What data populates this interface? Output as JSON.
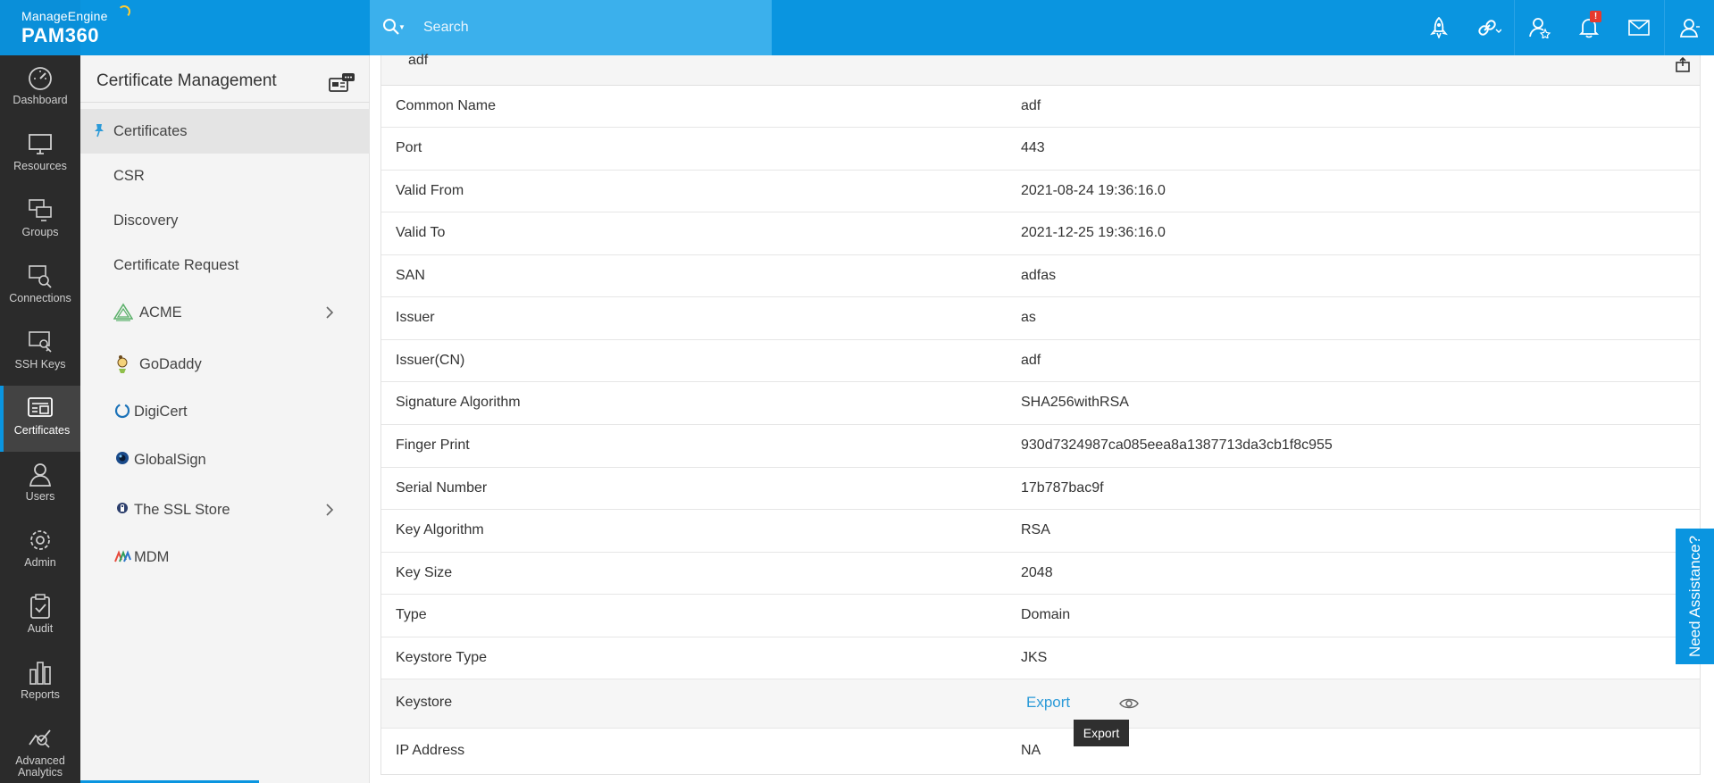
{
  "brand": {
    "small": "ManageEngine",
    "big": "PAM360"
  },
  "search": {
    "placeholder": "Search"
  },
  "top_icons": [
    "rocket-icon",
    "link-icon",
    "user-star-icon",
    "bell-icon",
    "mail-icon",
    "user-icon"
  ],
  "notification_badge": "!",
  "leftnav": {
    "items": [
      {
        "label": "Dashboard",
        "icon": "dashboard-icon"
      },
      {
        "label": "Resources",
        "icon": "monitor-icon"
      },
      {
        "label": "Groups",
        "icon": "groups-icon"
      },
      {
        "label": "Connections",
        "icon": "connections-icon"
      },
      {
        "label": "SSH Keys",
        "icon": "ssh-keys-icon"
      },
      {
        "label": "Certificates",
        "icon": "certificate-icon",
        "active": true
      },
      {
        "label": "Users",
        "icon": "users-icon"
      },
      {
        "label": "Admin",
        "icon": "gear-icon"
      },
      {
        "label": "Audit",
        "icon": "clipboard-icon"
      },
      {
        "label": "Reports",
        "icon": "bar-chart-icon"
      },
      {
        "label": "Advanced Analytics",
        "icon": "analytics-icon"
      }
    ]
  },
  "subnav": {
    "title": "Certificate Management",
    "items": [
      {
        "label": "Certificates",
        "active": true
      },
      {
        "label": "CSR"
      },
      {
        "label": "Discovery"
      },
      {
        "label": "Certificate Request"
      },
      {
        "label": "ACME",
        "icon": "acme-icon",
        "submenu": true
      },
      {
        "label": "GoDaddy",
        "icon": "godaddy-icon"
      },
      {
        "label": "DigiCert",
        "icon": "digicert-icon"
      },
      {
        "label": "GlobalSign",
        "icon": "globalsign-icon"
      },
      {
        "label": "The SSL Store",
        "icon": "ssl-store-icon",
        "submenu": true
      },
      {
        "label": "MDM",
        "icon": "mdm-icon"
      }
    ]
  },
  "details": {
    "header": "adf",
    "rows": [
      {
        "key": "Common Name",
        "value": "adf"
      },
      {
        "key": "Port",
        "value": "443"
      },
      {
        "key": "Valid From",
        "value": "2021-08-24 19:36:16.0"
      },
      {
        "key": "Valid To",
        "value": "2021-12-25 19:36:16.0"
      },
      {
        "key": "SAN",
        "value": "adfas"
      },
      {
        "key": "Issuer",
        "value": "as"
      },
      {
        "key": "Issuer(CN)",
        "value": "adf"
      },
      {
        "key": "Signature Algorithm",
        "value": "SHA256withRSA"
      },
      {
        "key": "Finger Print",
        "value": "930d7324987ca085eea8a1387713da3cb1f8c955"
      },
      {
        "key": "Serial Number",
        "value": "17b787bac9f"
      },
      {
        "key": "Key Algorithm",
        "value": "RSA"
      },
      {
        "key": "Key Size",
        "value": "2048"
      },
      {
        "key": "Type",
        "value": "Domain"
      },
      {
        "key": "Keystore Type",
        "value": "JKS"
      }
    ],
    "keystore": {
      "key": "Keystore",
      "link": "Export",
      "tooltip": "Export"
    },
    "ip_address": {
      "key": "IP Address",
      "value": "NA"
    }
  },
  "assistance": {
    "label": "Need Assistance?"
  },
  "colors": {
    "accent": "#0a95e0",
    "nav_bg": "#2b2b2b",
    "link": "#2b9ad8"
  }
}
